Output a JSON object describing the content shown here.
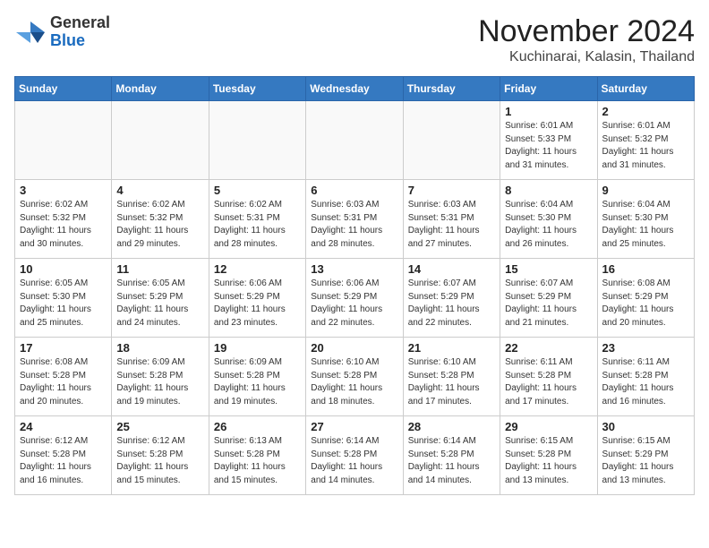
{
  "header": {
    "logo_general": "General",
    "logo_blue": "Blue",
    "month_title": "November 2024",
    "location": "Kuchinarai, Kalasin, Thailand"
  },
  "weekdays": [
    "Sunday",
    "Monday",
    "Tuesday",
    "Wednesday",
    "Thursday",
    "Friday",
    "Saturday"
  ],
  "weeks": [
    [
      {
        "day": "",
        "info": ""
      },
      {
        "day": "",
        "info": ""
      },
      {
        "day": "",
        "info": ""
      },
      {
        "day": "",
        "info": ""
      },
      {
        "day": "",
        "info": ""
      },
      {
        "day": "1",
        "info": "Sunrise: 6:01 AM\nSunset: 5:33 PM\nDaylight: 11 hours\nand 31 minutes."
      },
      {
        "day": "2",
        "info": "Sunrise: 6:01 AM\nSunset: 5:32 PM\nDaylight: 11 hours\nand 31 minutes."
      }
    ],
    [
      {
        "day": "3",
        "info": "Sunrise: 6:02 AM\nSunset: 5:32 PM\nDaylight: 11 hours\nand 30 minutes."
      },
      {
        "day": "4",
        "info": "Sunrise: 6:02 AM\nSunset: 5:32 PM\nDaylight: 11 hours\nand 29 minutes."
      },
      {
        "day": "5",
        "info": "Sunrise: 6:02 AM\nSunset: 5:31 PM\nDaylight: 11 hours\nand 28 minutes."
      },
      {
        "day": "6",
        "info": "Sunrise: 6:03 AM\nSunset: 5:31 PM\nDaylight: 11 hours\nand 28 minutes."
      },
      {
        "day": "7",
        "info": "Sunrise: 6:03 AM\nSunset: 5:31 PM\nDaylight: 11 hours\nand 27 minutes."
      },
      {
        "day": "8",
        "info": "Sunrise: 6:04 AM\nSunset: 5:30 PM\nDaylight: 11 hours\nand 26 minutes."
      },
      {
        "day": "9",
        "info": "Sunrise: 6:04 AM\nSunset: 5:30 PM\nDaylight: 11 hours\nand 25 minutes."
      }
    ],
    [
      {
        "day": "10",
        "info": "Sunrise: 6:05 AM\nSunset: 5:30 PM\nDaylight: 11 hours\nand 25 minutes."
      },
      {
        "day": "11",
        "info": "Sunrise: 6:05 AM\nSunset: 5:29 PM\nDaylight: 11 hours\nand 24 minutes."
      },
      {
        "day": "12",
        "info": "Sunrise: 6:06 AM\nSunset: 5:29 PM\nDaylight: 11 hours\nand 23 minutes."
      },
      {
        "day": "13",
        "info": "Sunrise: 6:06 AM\nSunset: 5:29 PM\nDaylight: 11 hours\nand 22 minutes."
      },
      {
        "day": "14",
        "info": "Sunrise: 6:07 AM\nSunset: 5:29 PM\nDaylight: 11 hours\nand 22 minutes."
      },
      {
        "day": "15",
        "info": "Sunrise: 6:07 AM\nSunset: 5:29 PM\nDaylight: 11 hours\nand 21 minutes."
      },
      {
        "day": "16",
        "info": "Sunrise: 6:08 AM\nSunset: 5:29 PM\nDaylight: 11 hours\nand 20 minutes."
      }
    ],
    [
      {
        "day": "17",
        "info": "Sunrise: 6:08 AM\nSunset: 5:28 PM\nDaylight: 11 hours\nand 20 minutes."
      },
      {
        "day": "18",
        "info": "Sunrise: 6:09 AM\nSunset: 5:28 PM\nDaylight: 11 hours\nand 19 minutes."
      },
      {
        "day": "19",
        "info": "Sunrise: 6:09 AM\nSunset: 5:28 PM\nDaylight: 11 hours\nand 19 minutes."
      },
      {
        "day": "20",
        "info": "Sunrise: 6:10 AM\nSunset: 5:28 PM\nDaylight: 11 hours\nand 18 minutes."
      },
      {
        "day": "21",
        "info": "Sunrise: 6:10 AM\nSunset: 5:28 PM\nDaylight: 11 hours\nand 17 minutes."
      },
      {
        "day": "22",
        "info": "Sunrise: 6:11 AM\nSunset: 5:28 PM\nDaylight: 11 hours\nand 17 minutes."
      },
      {
        "day": "23",
        "info": "Sunrise: 6:11 AM\nSunset: 5:28 PM\nDaylight: 11 hours\nand 16 minutes."
      }
    ],
    [
      {
        "day": "24",
        "info": "Sunrise: 6:12 AM\nSunset: 5:28 PM\nDaylight: 11 hours\nand 16 minutes."
      },
      {
        "day": "25",
        "info": "Sunrise: 6:12 AM\nSunset: 5:28 PM\nDaylight: 11 hours\nand 15 minutes."
      },
      {
        "day": "26",
        "info": "Sunrise: 6:13 AM\nSunset: 5:28 PM\nDaylight: 11 hours\nand 15 minutes."
      },
      {
        "day": "27",
        "info": "Sunrise: 6:14 AM\nSunset: 5:28 PM\nDaylight: 11 hours\nand 14 minutes."
      },
      {
        "day": "28",
        "info": "Sunrise: 6:14 AM\nSunset: 5:28 PM\nDaylight: 11 hours\nand 14 minutes."
      },
      {
        "day": "29",
        "info": "Sunrise: 6:15 AM\nSunset: 5:28 PM\nDaylight: 11 hours\nand 13 minutes."
      },
      {
        "day": "30",
        "info": "Sunrise: 6:15 AM\nSunset: 5:29 PM\nDaylight: 11 hours\nand 13 minutes."
      }
    ]
  ]
}
